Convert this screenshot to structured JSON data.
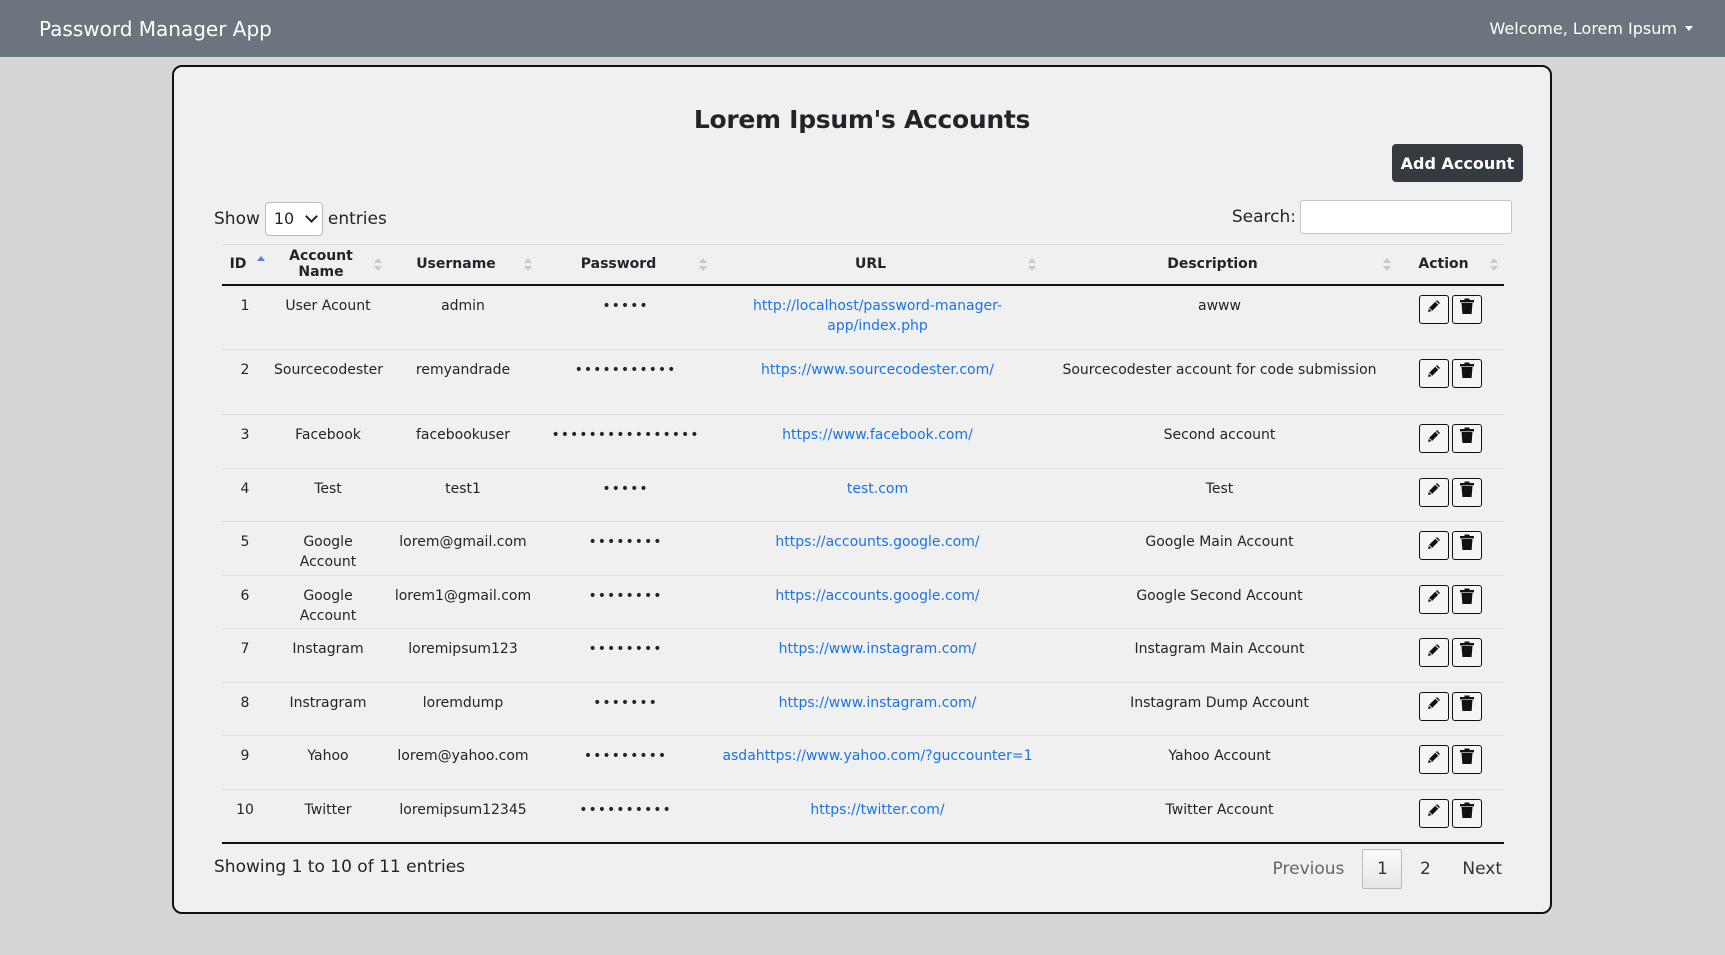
{
  "navbar": {
    "brand": "Password Manager App",
    "welcome": "Welcome, Lorem Ipsum"
  },
  "page": {
    "title": "Lorem Ipsum's Accounts",
    "add_button": "Add Account"
  },
  "length_control": {
    "show": "Show",
    "value": "10",
    "entries": "entries"
  },
  "search": {
    "label": "Search:",
    "value": ""
  },
  "table": {
    "columns": [
      "ID",
      "Account Name",
      "Username",
      "Password",
      "URL",
      "Description",
      "Action"
    ],
    "rows": [
      {
        "id": "1",
        "name": "User Acount",
        "username": "admin",
        "password": "•••••",
        "url": "http://localhost/password-manager-app/index.php",
        "description": "awww"
      },
      {
        "id": "2",
        "name": "Sourcecodester",
        "username": "remyandrade",
        "password": "•••••••••••",
        "url": "https://www.sourcecodester.com/",
        "description": "Sourcecodester account for code submission"
      },
      {
        "id": "3",
        "name": "Facebook",
        "username": "facebookuser",
        "password": "••••••••••••••••",
        "url": "https://www.facebook.com/",
        "description": "Second account"
      },
      {
        "id": "4",
        "name": "Test",
        "username": "test1",
        "password": "•••••",
        "url": "test.com",
        "description": "Test"
      },
      {
        "id": "5",
        "name": "Google Account",
        "username": "lorem@gmail.com",
        "password": "••••••••",
        "url": "https://accounts.google.com/",
        "description": "Google Main Account"
      },
      {
        "id": "6",
        "name": "Google Account",
        "username": "lorem1@gmail.com",
        "password": "••••••••",
        "url": "https://accounts.google.com/",
        "description": "Google Second Account"
      },
      {
        "id": "7",
        "name": "Instagram",
        "username": "loremipsum123",
        "password": "••••••••",
        "url": "https://www.instagram.com/",
        "description": "Instagram Main Account"
      },
      {
        "id": "8",
        "name": "Instragram",
        "username": "loremdump",
        "password": "•••••••",
        "url": "https://www.instagram.com/",
        "description": "Instagram Dump Account"
      },
      {
        "id": "9",
        "name": "Yahoo",
        "username": "lorem@yahoo.com",
        "password": "•••••••••",
        "url": "asdahttps://www.yahoo.com/?guccounter=1",
        "description": "Yahoo Account"
      },
      {
        "id": "10",
        "name": "Twitter",
        "username": "loremipsum12345",
        "password": "••••••••••",
        "url": "https://twitter.com/",
        "description": "Twitter Account"
      }
    ]
  },
  "footer": {
    "info": "Showing 1 to 10 of 11 entries",
    "pagination": {
      "previous": "Previous",
      "pages": [
        "1",
        "2"
      ],
      "current": "1",
      "next": "Next"
    }
  },
  "icons": {
    "edit": "pencil-icon",
    "delete": "trash-icon",
    "dropdown": "caret-down-icon"
  }
}
